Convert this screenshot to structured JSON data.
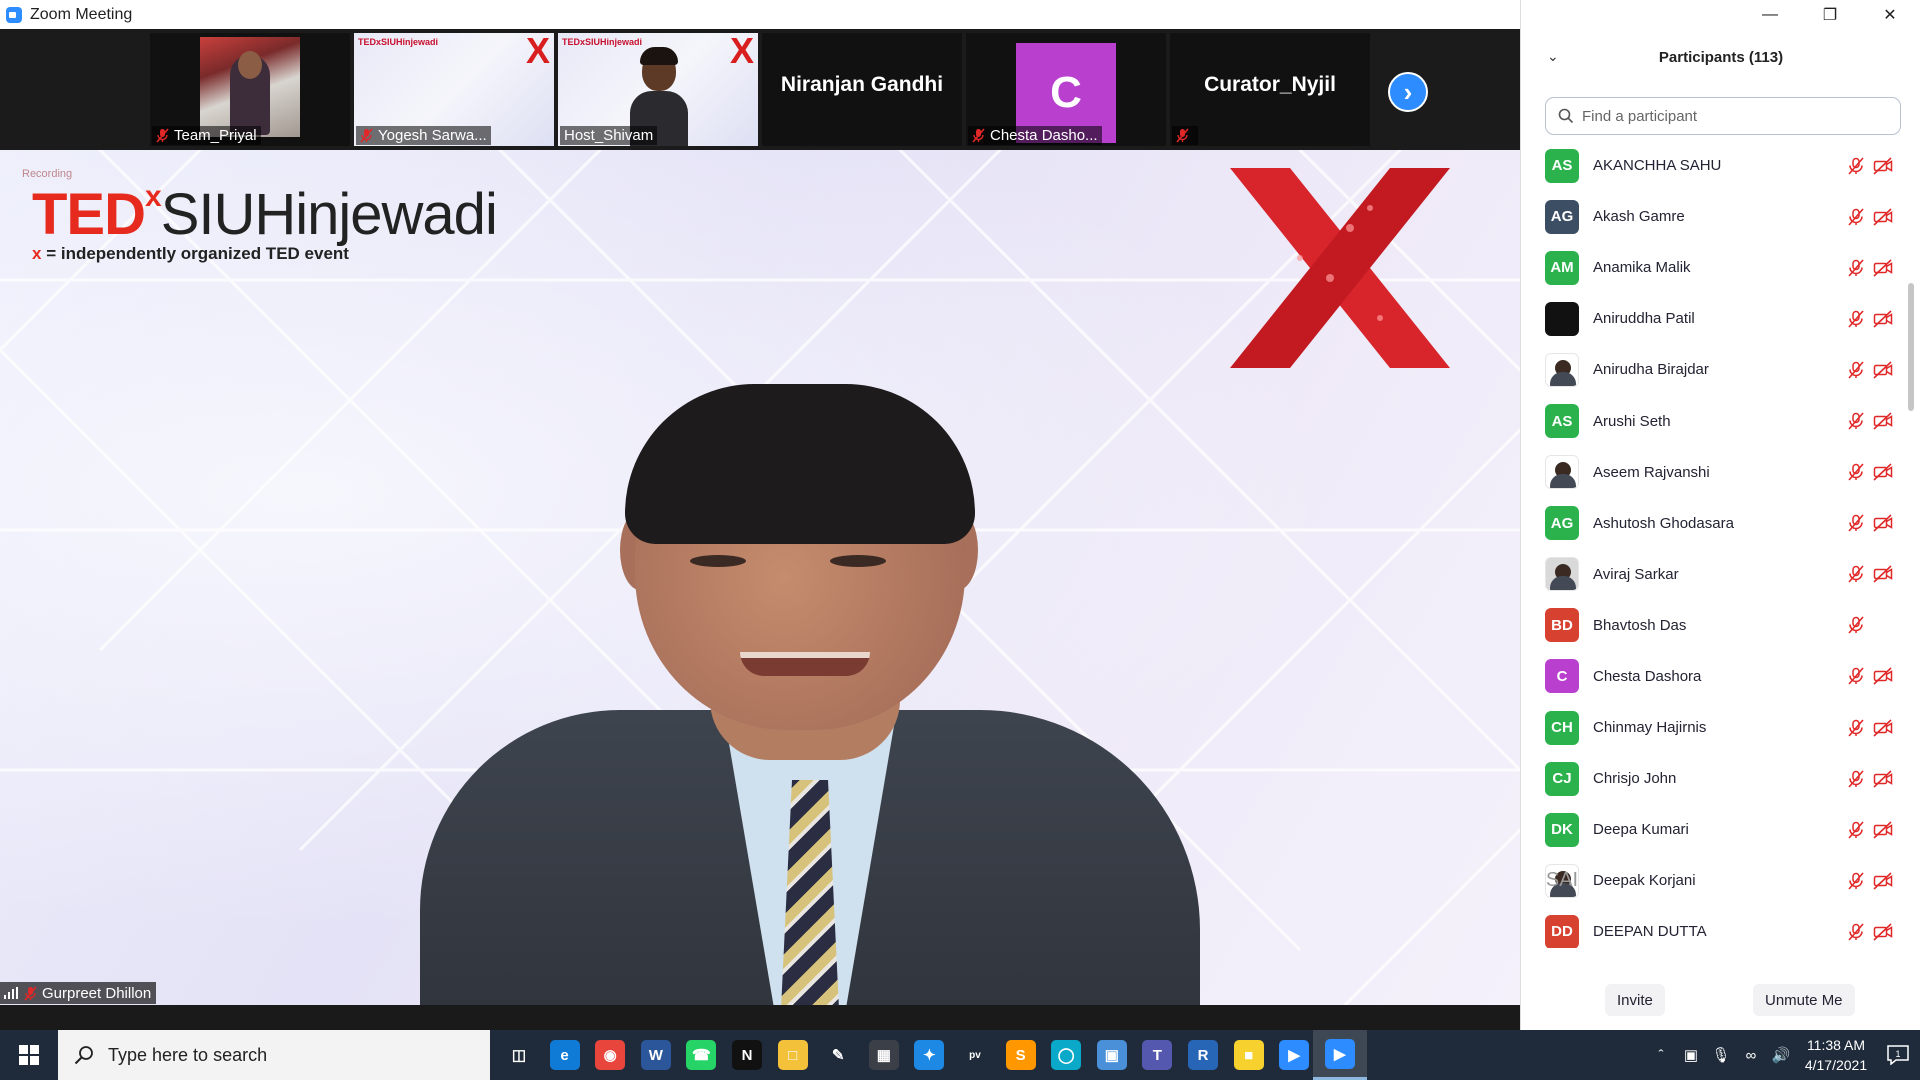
{
  "window": {
    "title": "Zoom Meeting"
  },
  "strip": {
    "tiles": [
      {
        "name": "Team_Priyal"
      },
      {
        "name": "Yogesh Sarwa...",
        "banner": "TEDxSIUHinjewadi"
      },
      {
        "name": "Host_Shivam",
        "banner": "TEDxSIUHinjewadi"
      },
      {
        "display_name": "Niranjan Gandhi"
      },
      {
        "name": "Chesta Dasho...",
        "initial": "C"
      },
      {
        "display_name": "Curator_Nyjil"
      }
    ],
    "next_icon": "chevron-right-icon"
  },
  "main": {
    "speaker_name": "Gurpreet Dhillon",
    "recording_label": "Recording",
    "logo_ted": "TED",
    "logo_x": "x",
    "logo_event": "SIUHinjewadi",
    "logo_tagline_x": "x",
    "logo_tagline": " = independently organized TED event"
  },
  "participants": {
    "title": "Participants (113)",
    "search_placeholder": "Find a participant",
    "list": [
      {
        "name": "AKANCHHA SAHU",
        "initials": "AS",
        "color": "#2bb24c",
        "video_off": true
      },
      {
        "name": "Akash Gamre",
        "initials": "AG",
        "color": "#3b4e63",
        "video_off": true
      },
      {
        "name": "Anamika Malik",
        "initials": "AM",
        "color": "#2bb24c",
        "video_off": true
      },
      {
        "name": "Aniruddha Patil",
        "initials": "",
        "color": "#111111",
        "video_off": true
      },
      {
        "name": "Anirudha Birajdar",
        "initials": "",
        "color": "#ffffff",
        "photo": true,
        "video_off": true
      },
      {
        "name": "Arushi Seth",
        "initials": "AS",
        "color": "#2bb24c",
        "video_off": true
      },
      {
        "name": "Aseem Rajvanshi",
        "initials": "",
        "color": "#ffffff",
        "photo": true,
        "video_off": true
      },
      {
        "name": "Ashutosh Ghodasara",
        "initials": "AG",
        "color": "#2bb24c",
        "video_off": true
      },
      {
        "name": "Aviraj Sarkar",
        "initials": "",
        "color": "#d9d9d9",
        "photo": true,
        "video_off": true
      },
      {
        "name": "Bhavtosh Das",
        "initials": "BD",
        "color": "#d7412f",
        "video_off": false
      },
      {
        "name": "Chesta Dashora",
        "initials": "C",
        "color": "#b93fcf",
        "video_off": true
      },
      {
        "name": "Chinmay Hajirnis",
        "initials": "CH",
        "color": "#2bb24c",
        "video_off": true
      },
      {
        "name": "Chrisjo John",
        "initials": "CJ",
        "color": "#2bb24c",
        "video_off": true
      },
      {
        "name": "Deepa Kumari",
        "initials": "DK",
        "color": "#2bb24c",
        "video_off": true
      },
      {
        "name": "Deepak Korjani",
        "initials": "SAI",
        "color": "#ffffff",
        "photo": true,
        "video_off": true
      },
      {
        "name": "DEEPAN DUTTA",
        "initials": "DD",
        "color": "#d7412f",
        "video_off": true
      }
    ],
    "invite_label": "Invite",
    "unmute_label": "Unmute Me"
  },
  "taskbar": {
    "search_placeholder": "Type here to search",
    "time": "11:38 AM",
    "date": "4/17/2021",
    "notification_count": "1",
    "apps": [
      "task-view-icon",
      "edge-icon",
      "chrome-icon",
      "word-icon",
      "whatsapp-icon",
      "netflix-icon",
      "file-explorer-icon",
      "clipboard-icon",
      "store-icon",
      "safari-icon",
      "prime-video-icon",
      "sublime-icon",
      "instagram-icon",
      "photos-icon",
      "teams-icon",
      "r-icon",
      "sticky-notes-icon",
      "zoom-icon",
      "zoom-meeting-icon"
    ]
  }
}
